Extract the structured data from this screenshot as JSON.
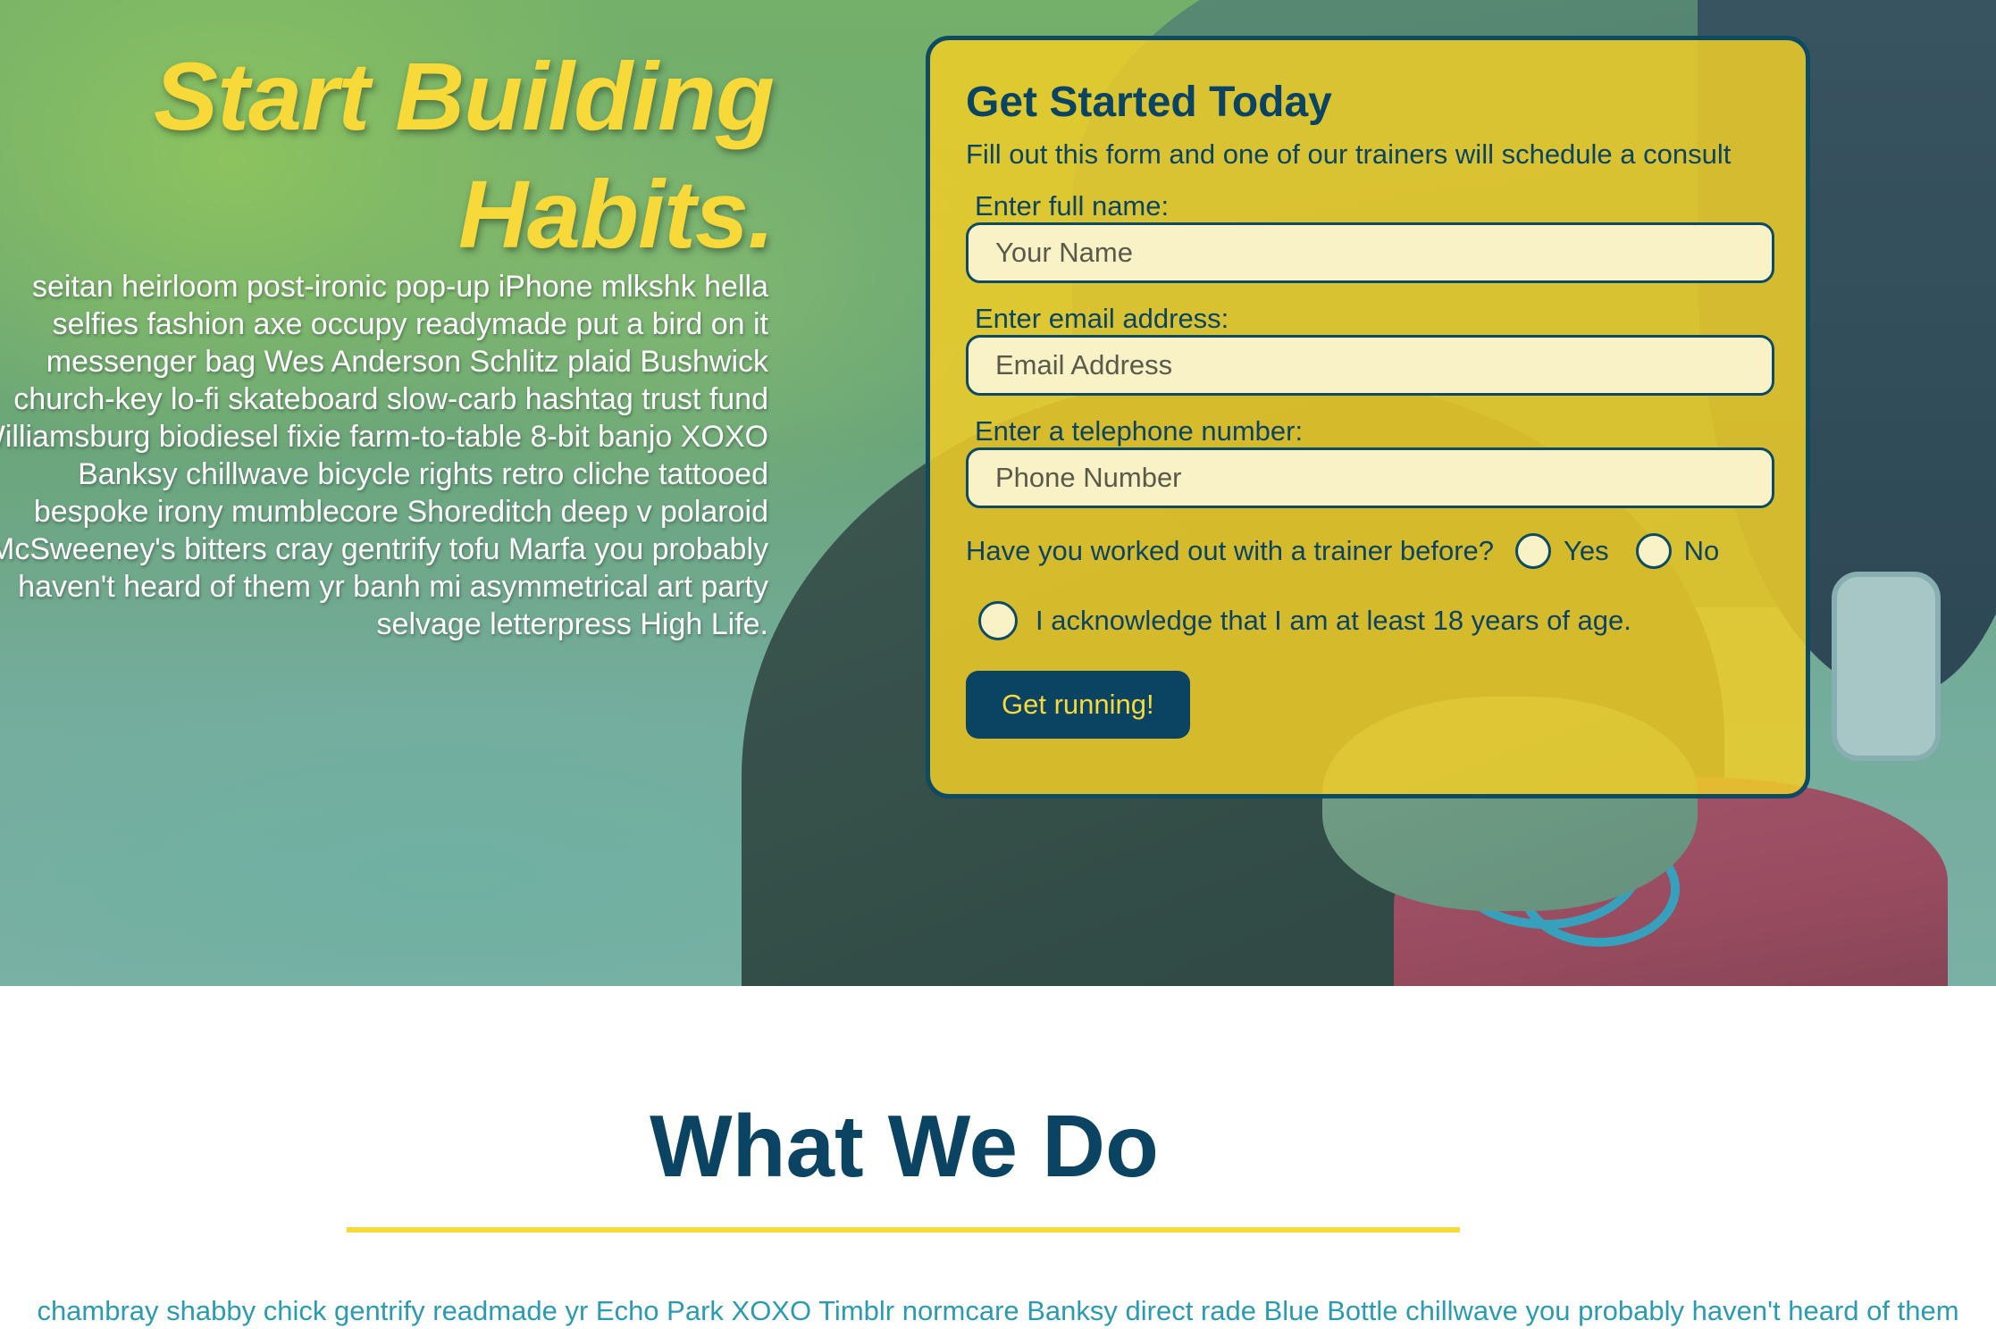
{
  "hero": {
    "headline": "Start Building Habits.",
    "intro": "seitan heirloom post-ironic pop-up iPhone mlkshk hella selfies fashion axe occupy readymade put a bird on it messenger bag Wes Anderson Schlitz plaid Bushwick church-key lo-fi skateboard slow-carb hashtag trust fund Williamsburg biodiesel fixie farm-to-table 8-bit banjo XOXO Banksy chillwave bicycle rights retro cliche tattooed bespoke irony mumblecore Shoreditch deep v polaroid McSweeney's bitters cray gentrify tofu Marfa you probably haven't heard of them yr banh mi asymmetrical art party selvage letterpress High Life."
  },
  "form": {
    "title": "Get Started Today",
    "subtitle": "Fill out this form and one of our trainers will schedule a consult",
    "name_label": "Enter full name:",
    "name_placeholder": "Your Name",
    "email_label": "Enter email address:",
    "email_placeholder": "Email Address",
    "phone_label": "Enter a telephone number:",
    "phone_placeholder": "Phone Number",
    "trainer_question": "Have you worked out with a trainer before?",
    "yes_label": "Yes",
    "no_label": "No",
    "age_ack": "I acknowledge that I am at least 18 years of age.",
    "submit_label": "Get running!"
  },
  "what_we_do": {
    "title": "What We Do",
    "text": "chambray shabby chick gentrify readmade yr Echo Park XOXO Timblr normcare Banksy direct rade Blue Bottle chillwave you probably haven't heard of them"
  },
  "colors": {
    "navy": "#0b4463",
    "yellow": "#f7d93a",
    "teal_text": "#2a9bb0"
  }
}
